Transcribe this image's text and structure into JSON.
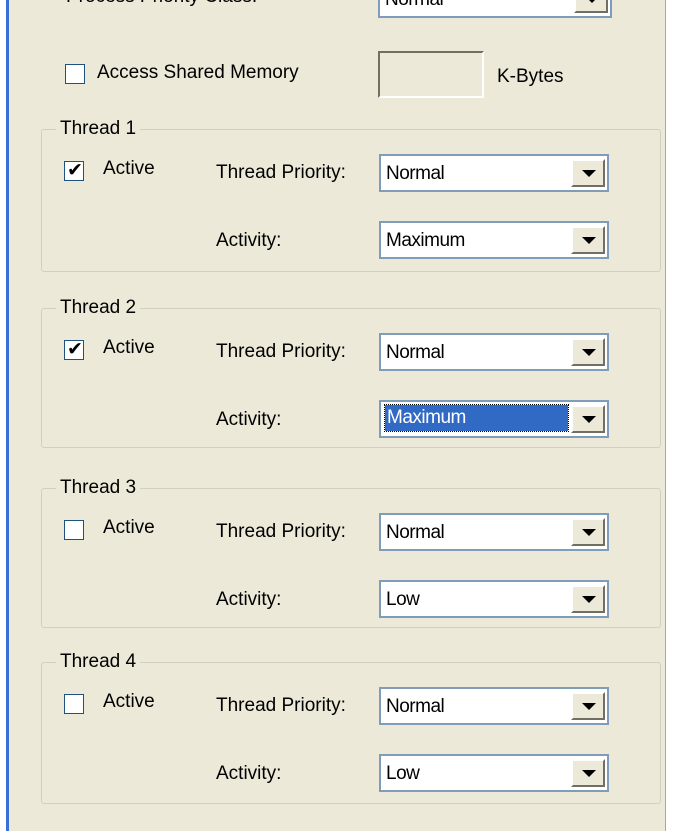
{
  "top_row": {
    "label": "Process Priority Class:",
    "value": "Normal"
  },
  "shared_memory": {
    "checkbox_label": "Access Shared Memory",
    "checked": false,
    "size_value": "",
    "unit_label": "K-Bytes"
  },
  "threads": [
    {
      "title": "Thread 1",
      "active_label": "Active",
      "active": true,
      "priority_label": "Thread Priority:",
      "priority_value": "Normal",
      "activity_label": "Activity:",
      "activity_value": "Maximum",
      "activity_focused": false
    },
    {
      "title": "Thread 2",
      "active_label": "Active",
      "active": true,
      "priority_label": "Thread Priority:",
      "priority_value": "Normal",
      "activity_label": "Activity:",
      "activity_value": "Maximum",
      "activity_focused": true
    },
    {
      "title": "Thread 3",
      "active_label": "Active",
      "active": false,
      "priority_label": "Thread Priority:",
      "priority_value": "Normal",
      "activity_label": "Activity:",
      "activity_value": "Low",
      "activity_focused": false
    },
    {
      "title": "Thread 4",
      "active_label": "Active",
      "active": false,
      "priority_label": "Thread Priority:",
      "priority_value": "Normal",
      "activity_label": "Activity:",
      "activity_value": "Low",
      "activity_focused": false
    }
  ],
  "colors": {
    "dialog_background": "#ece9d8",
    "selection_highlight": "#316ac5",
    "window_border_accent": "#3a6fd8",
    "field_border": "#7f9db9"
  },
  "icons": {
    "dropdown_arrow": "chevron-down-icon",
    "checkmark": "checkmark-icon"
  }
}
